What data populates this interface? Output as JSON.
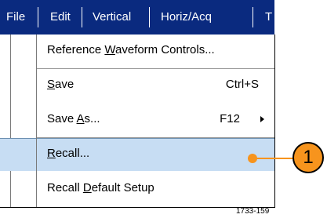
{
  "menubar": {
    "items": [
      "File",
      "Edit",
      "Vertical",
      "Horiz/Acq",
      "T"
    ]
  },
  "dropdown": {
    "items": [
      {
        "label_before": "Reference ",
        "mnemonic": "W",
        "label_after": "aveform Controls...",
        "shortcut": ""
      },
      {
        "label_before": "",
        "mnemonic": "S",
        "label_after": "ave",
        "shortcut": "Ctrl+S"
      },
      {
        "label_before": "Save ",
        "mnemonic": "A",
        "label_after": "s...",
        "shortcut": "F12",
        "submenu": true
      },
      {
        "label_before": "",
        "mnemonic": "R",
        "label_after": "ecall...",
        "shortcut": "",
        "selected": true
      },
      {
        "label_before": "Recall ",
        "mnemonic": "D",
        "label_after": "efault Setup",
        "shortcut": ""
      }
    ]
  },
  "callout": {
    "number": "1",
    "color": "#f7941d"
  },
  "figure_id": "1733-159",
  "colors": {
    "menubar": "#0a2a7f",
    "highlight": "#c7ddf3"
  }
}
